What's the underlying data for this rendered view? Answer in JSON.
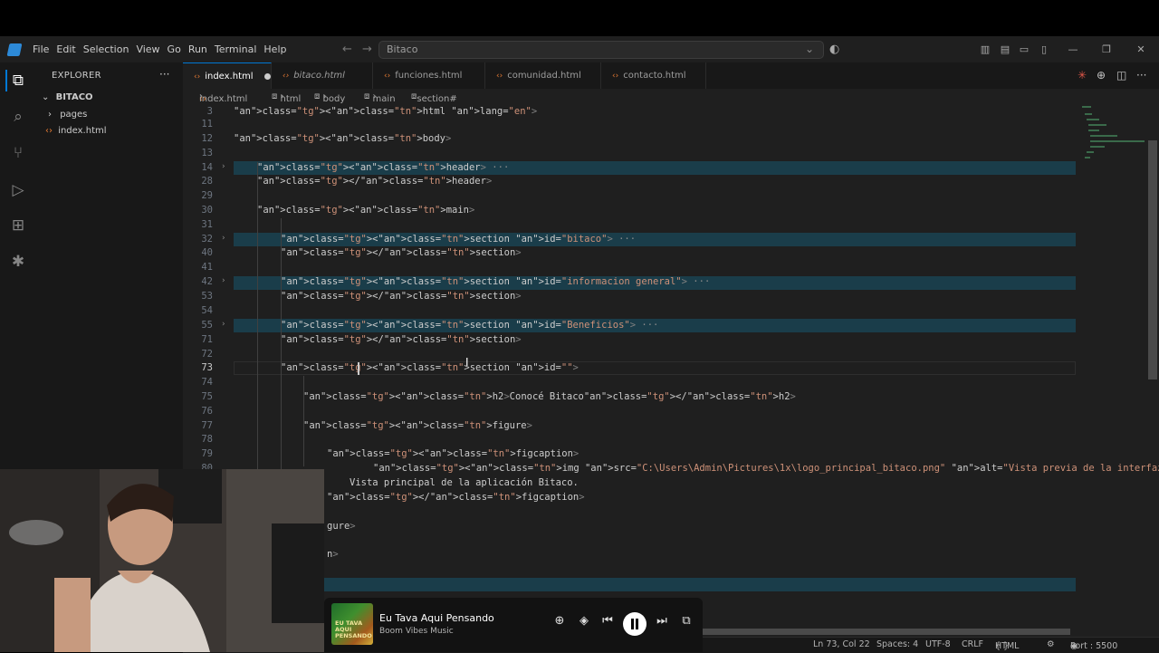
{
  "menu": [
    "File",
    "Edit",
    "Selection",
    "View",
    "Go",
    "Run",
    "Terminal",
    "Help"
  ],
  "command_center": "Bitaco",
  "explorer": {
    "header": "EXPLORER",
    "root": "BITACO",
    "items": [
      {
        "label": "pages",
        "kind": "folder"
      },
      {
        "label": "index.html",
        "kind": "file"
      }
    ]
  },
  "tabs": [
    {
      "label": "index.html",
      "active": true,
      "modified": true
    },
    {
      "label": "bitaco.html",
      "active": false,
      "italic": true
    },
    {
      "label": "funciones.html",
      "active": false
    },
    {
      "label": "comunidad.html",
      "active": false
    },
    {
      "label": "contacto.html",
      "active": false
    }
  ],
  "breadcrumb": [
    "index.html",
    "html",
    "body",
    "main",
    "section#"
  ],
  "code_lines": [
    {
      "n": "3",
      "text": "<html lang=\"en\">"
    },
    {
      "n": "11",
      "text": ""
    },
    {
      "n": "12",
      "text": "<body>"
    },
    {
      "n": "13",
      "text": ""
    },
    {
      "n": "14",
      "text": "<header> ···"
    },
    {
      "n": "28",
      "text": "</header>"
    },
    {
      "n": "29",
      "text": ""
    },
    {
      "n": "30",
      "text": "<main>"
    },
    {
      "n": "31",
      "text": ""
    },
    {
      "n": "32",
      "text": "<section id=\"bitaco\"> ···"
    },
    {
      "n": "40",
      "text": "</section>"
    },
    {
      "n": "41",
      "text": ""
    },
    {
      "n": "42",
      "text": "<section id=\"informacion general\"> ···"
    },
    {
      "n": "53",
      "text": "</section>"
    },
    {
      "n": "54",
      "text": ""
    },
    {
      "n": "55",
      "text": "<section id=\"Beneficios\"> ···"
    },
    {
      "n": "71",
      "text": "</section>"
    },
    {
      "n": "72",
      "text": ""
    },
    {
      "n": "73",
      "text": "<section id=\"\">"
    },
    {
      "n": "74",
      "text": ""
    },
    {
      "n": "75",
      "text": "<h2>Conocé Bitaco</h2>"
    },
    {
      "n": "76",
      "text": ""
    },
    {
      "n": "77",
      "text": "<figure>"
    },
    {
      "n": "78",
      "text": ""
    },
    {
      "n": "79",
      "text": "<figcaption>"
    },
    {
      "n": "80",
      "text": "<img src=\"C:\\Users\\Admin\\Pictures\\1x\\logo_principal_bitaco.png\" alt=\"Vista previa de la interfaz principal de Bitaco\">"
    },
    {
      "n": "",
      "text": "Vista principal de la aplicación Bitaco."
    },
    {
      "n": "",
      "text": "</figcaption>"
    },
    {
      "n": "",
      "text": "gure>"
    },
    {
      "n": "",
      "text": "n>"
    }
  ],
  "status": {
    "position": "Ln 73, Col 22",
    "spaces": "Spaces: 4",
    "encoding": "UTF-8",
    "eol": "CRLF",
    "language": "HTML",
    "port": "Port : 5500"
  },
  "player": {
    "track": "Eu Tava Aqui Pensando",
    "artist": "Boom Vibes Music",
    "art_text": "EU TAVA AQUI PENSANDO"
  }
}
